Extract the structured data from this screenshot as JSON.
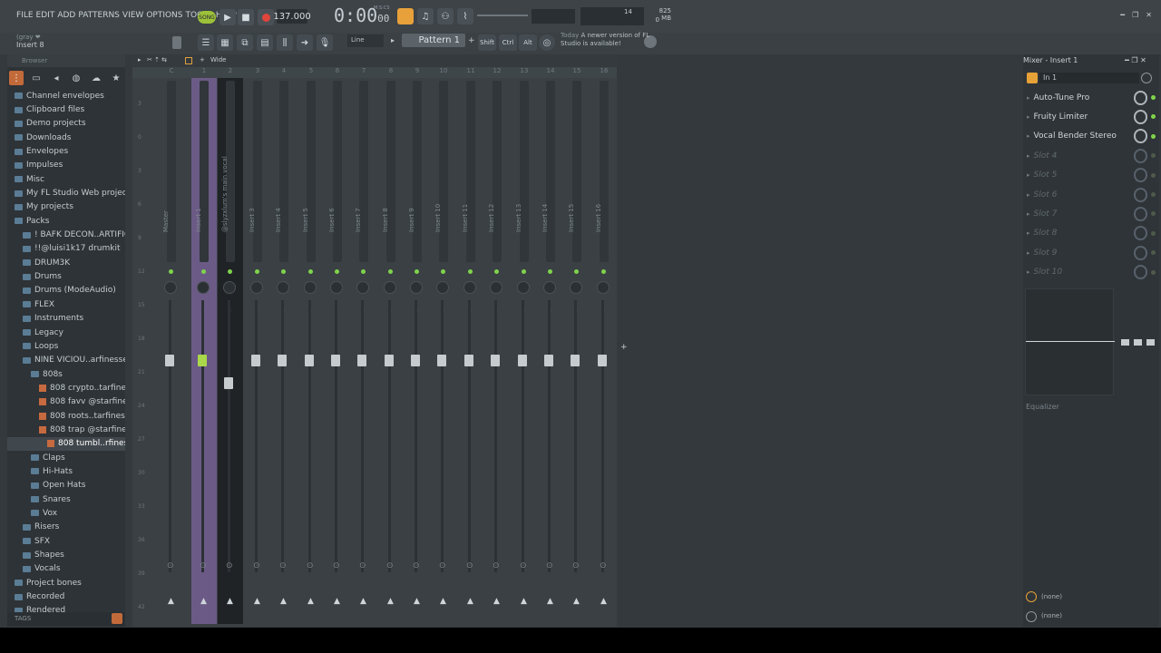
{
  "menu": [
    "FILE",
    "EDIT",
    "ADD",
    "PATTERNS",
    "VIEW",
    "OPTIONS",
    "TOOLS",
    "HELP"
  ],
  "transport": {
    "mode": "SONG",
    "tempo": "137.000",
    "time": "0:00",
    "time_sub": "00",
    "time_unit": "M:S:CS",
    "cpu": "14",
    "mem": "825 MB",
    "poly": "0"
  },
  "hint": {
    "top": "(gray ❤",
    "bottom": "Insert 8"
  },
  "toolbar": {
    "line": "Line",
    "pattern": "Pattern 1",
    "shift": "Shift",
    "ctrl": "Ctrl",
    "alt": "Alt"
  },
  "news": {
    "day": "Today",
    "msg": "A newer version of FL Studio is available!"
  },
  "browser": {
    "title": "Browser",
    "items": [
      {
        "label": "Channel envelopes",
        "depth": 0,
        "type": "folder"
      },
      {
        "label": "Clipboard files",
        "depth": 0,
        "type": "folder"
      },
      {
        "label": "Demo projects",
        "depth": 0,
        "type": "folder"
      },
      {
        "label": "Downloads",
        "depth": 0,
        "type": "folder"
      },
      {
        "label": "Envelopes",
        "depth": 0,
        "type": "folder"
      },
      {
        "label": "Impulses",
        "depth": 0,
        "type": "folder"
      },
      {
        "label": "Misc",
        "depth": 0,
        "type": "folder"
      },
      {
        "label": "My FL Studio Web projects",
        "depth": 0,
        "type": "folder"
      },
      {
        "label": "My projects",
        "depth": 0,
        "type": "folder"
      },
      {
        "label": "Packs",
        "depth": 0,
        "type": "folder"
      },
      {
        "label": "! BAFK DECON..ARTIFICIAL",
        "depth": 1,
        "type": "folder"
      },
      {
        "label": "!!@luisi1k17 drumkit",
        "depth": 1,
        "type": "folder"
      },
      {
        "label": "DRUM3K",
        "depth": 1,
        "type": "folder"
      },
      {
        "label": "Drums",
        "depth": 1,
        "type": "folder"
      },
      {
        "label": "Drums (ModeAudio)",
        "depth": 1,
        "type": "folder"
      },
      {
        "label": "FLEX",
        "depth": 1,
        "type": "folder"
      },
      {
        "label": "Instruments",
        "depth": 1,
        "type": "folder"
      },
      {
        "label": "Legacy",
        "depth": 1,
        "type": "folder"
      },
      {
        "label": "Loops",
        "depth": 1,
        "type": "folder"
      },
      {
        "label": "NINE VICIOU..arfinesse_",
        "depth": 1,
        "type": "folder"
      },
      {
        "label": "808s",
        "depth": 2,
        "type": "folder"
      },
      {
        "label": "808 crypto..tarfinesse_",
        "depth": 3,
        "type": "audio"
      },
      {
        "label": "808 favv @starfinesse_",
        "depth": 3,
        "type": "audio"
      },
      {
        "label": "808 roots..tarfinesse_",
        "depth": 3,
        "type": "audio"
      },
      {
        "label": "808 trap @starfinesse_",
        "depth": 3,
        "type": "audio"
      },
      {
        "label": "808 tumbl..rfinesse_",
        "depth": 4,
        "type": "audio",
        "selected": true
      },
      {
        "label": "Claps",
        "depth": 2,
        "type": "folder"
      },
      {
        "label": "Hi-Hats",
        "depth": 2,
        "type": "folder"
      },
      {
        "label": "Open Hats",
        "depth": 2,
        "type": "folder"
      },
      {
        "label": "Snares",
        "depth": 2,
        "type": "folder"
      },
      {
        "label": "Vox",
        "depth": 2,
        "type": "folder"
      },
      {
        "label": "Risers",
        "depth": 1,
        "type": "folder"
      },
      {
        "label": "SFX",
        "depth": 1,
        "type": "folder"
      },
      {
        "label": "Shapes",
        "depth": 1,
        "type": "folder"
      },
      {
        "label": "Vocals",
        "depth": 1,
        "type": "folder"
      },
      {
        "label": "Project bones",
        "depth": 0,
        "type": "folder"
      },
      {
        "label": "Recorded",
        "depth": 0,
        "type": "folder"
      },
      {
        "label": "Rendered",
        "depth": 0,
        "type": "folder"
      }
    ],
    "tags": "TAGS"
  },
  "mixer": {
    "view": "Wide",
    "strips": [
      {
        "num": "C",
        "name": "Master"
      },
      {
        "num": "1",
        "name": "Insert 1"
      },
      {
        "num": "2",
        "name": "@slyzxlum's main vocal"
      },
      {
        "num": "3",
        "name": "Insert 3"
      },
      {
        "num": "4",
        "name": "Insert 4"
      },
      {
        "num": "5",
        "name": "Insert 5"
      },
      {
        "num": "6",
        "name": "Insert 6"
      },
      {
        "num": "7",
        "name": "Insert 7"
      },
      {
        "num": "8",
        "name": "Insert 8"
      },
      {
        "num": "9",
        "name": "Insert 9"
      },
      {
        "num": "10",
        "name": "Insert 10"
      },
      {
        "num": "11",
        "name": "Insert 11"
      },
      {
        "num": "12",
        "name": "Insert 12"
      },
      {
        "num": "13",
        "name": "Insert 13"
      },
      {
        "num": "14",
        "name": "Insert 14"
      },
      {
        "num": "15",
        "name": "Insert 15"
      },
      {
        "num": "16",
        "name": "Insert 16"
      }
    ],
    "scale": [
      "3",
      "0",
      "3",
      "6",
      "9",
      "12",
      "15",
      "18",
      "21",
      "24",
      "27",
      "30",
      "33",
      "36",
      "39",
      "42"
    ]
  },
  "panel": {
    "title": "Mixer - Insert 1",
    "input": "In 1",
    "slots": [
      {
        "name": "Auto-Tune Pro",
        "empty": false
      },
      {
        "name": "Fruity Limiter",
        "empty": false
      },
      {
        "name": "Vocal Bender Stereo",
        "empty": false
      },
      {
        "name": "Slot 4",
        "empty": true
      },
      {
        "name": "Slot 5",
        "empty": true
      },
      {
        "name": "Slot 6",
        "empty": true
      },
      {
        "name": "Slot 7",
        "empty": true
      },
      {
        "name": "Slot 8",
        "empty": true
      },
      {
        "name": "Slot 9",
        "empty": true
      },
      {
        "name": "Slot 10",
        "empty": true
      }
    ],
    "eq": "Equalizer",
    "out1": "(none)",
    "out2": "(none)"
  }
}
